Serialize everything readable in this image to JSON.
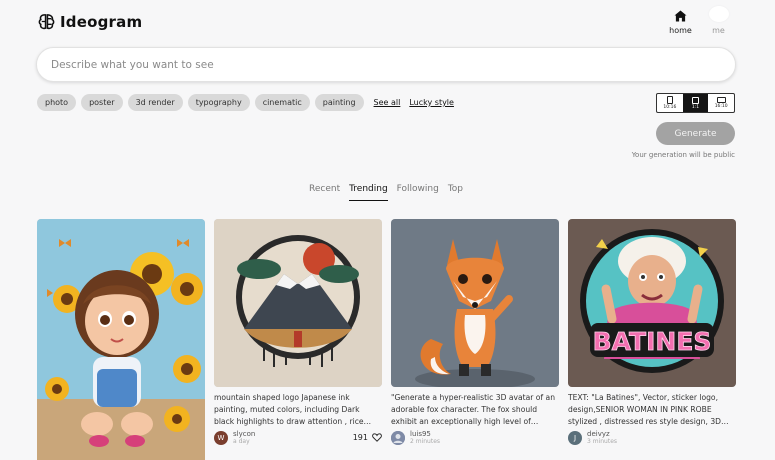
{
  "app": {
    "name": "Ideogram"
  },
  "nav": {
    "home_label": "home",
    "me_label": "me"
  },
  "search": {
    "placeholder": "Describe what you want to see"
  },
  "chips": [
    "photo",
    "poster",
    "3d render",
    "typography",
    "cinematic",
    "painting"
  ],
  "links": {
    "see_all": "See all",
    "lucky": "Lucky style"
  },
  "aspect_ratios": [
    {
      "label": "10:16",
      "shape": "tall",
      "selected": false
    },
    {
      "label": "1:1",
      "shape": "square",
      "selected": true
    },
    {
      "label": "16:10",
      "shape": "wide",
      "selected": false
    }
  ],
  "generate": {
    "label": "Generate",
    "note": "Your generation will be public"
  },
  "tabs": [
    {
      "label": "Recent",
      "active": false
    },
    {
      "label": "Trending",
      "active": true
    },
    {
      "label": "Following",
      "active": false
    },
    {
      "label": "Top",
      "active": false
    }
  ],
  "cards": [
    {
      "image": "girl-with-sunflowers-3d-render"
    },
    {
      "image": "mountain-logo-japanese-ink",
      "caption": "mountain shaped logo Japanese ink painting, muted colors, including Dark black highlights to draw attention , rice…",
      "user": "slycon",
      "initial": "W",
      "avatar_color": "#7a3e2e",
      "time": "a day",
      "likes": "191"
    },
    {
      "image": "3d-fox-avatar",
      "caption": "\"Generate a hyper-realistic 3D avatar of an adorable fox character. The fox should exhibit an exceptionally high level of…",
      "user": "luis95",
      "initial": "",
      "avatar_color": "#7e8aa6",
      "time": "2 minutes"
    },
    {
      "image": "la-batines-sticker-logo",
      "caption": "TEXT: \"La Batines\", Vector, sticker logo, design,SENIOR WOMAN IN PINK ROBE stylized , distressed res style design, 3D…",
      "user": "deivyz",
      "initial": "J",
      "avatar_color": "#5a6f7a",
      "time": "3 minutes"
    }
  ],
  "colors": {
    "background": "#f7f7f8",
    "generate_disabled": "#a3a3a3",
    "chip": "#d9d9d9",
    "selected_aspect": "#151515"
  }
}
